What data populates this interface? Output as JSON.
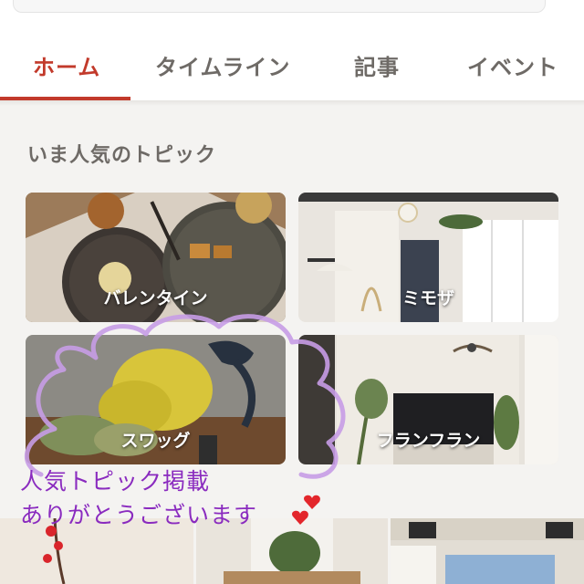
{
  "tabs": [
    {
      "label": "ホーム",
      "active": true
    },
    {
      "label": "タイムライン",
      "active": false
    },
    {
      "label": "記事",
      "active": false
    },
    {
      "label": "イベント",
      "active": false
    }
  ],
  "section": {
    "title": "いま人気のトピック"
  },
  "topics": [
    {
      "label": "バレンタイン"
    },
    {
      "label": "ミモザ"
    },
    {
      "label": "スワッグ"
    },
    {
      "label": "フランフラン"
    }
  ],
  "overlay": {
    "line1": "人気トピック掲載",
    "line2": "ありがとうございます"
  },
  "colors": {
    "accent": "#c23a2b",
    "overlay_ink": "#8a2bbf",
    "heart": "#e3262b"
  }
}
